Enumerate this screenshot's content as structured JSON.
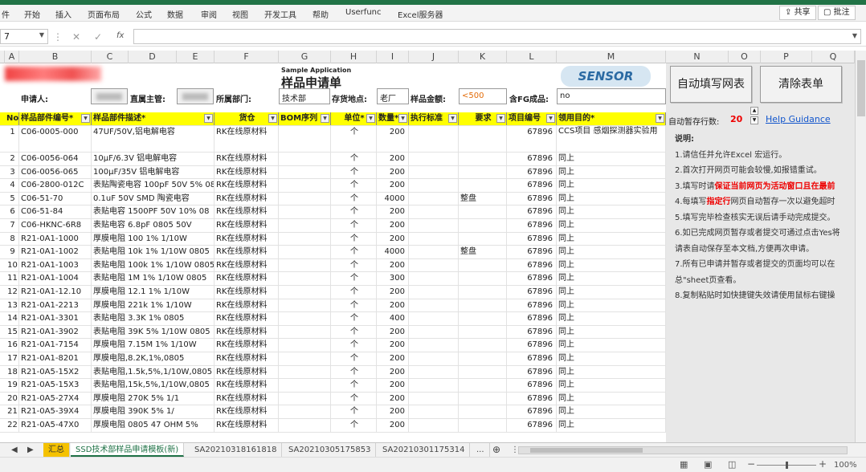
{
  "menu": {
    "items": [
      "件",
      "开始",
      "插入",
      "页面布局",
      "公式",
      "数据",
      "审阅",
      "视图",
      "开发工具",
      "帮助",
      "Userfunc",
      "Excel服务器"
    ],
    "share": "共享",
    "comment": "批注"
  },
  "formula_bar": {
    "name_box": "7",
    "fx": "fx",
    "content": ""
  },
  "columns": [
    "A",
    "B",
    "C",
    "D",
    "E",
    "F",
    "G",
    "H",
    "I",
    "J",
    "K",
    "L",
    "M",
    "N",
    "O",
    "P",
    "Q"
  ],
  "form": {
    "sample_application": "Sample Application",
    "title": "样品申请单",
    "applicant_label": "申请人:",
    "supervisor_label": "直属主管:",
    "dept_label": "所属部门:",
    "dept_value": "技术部",
    "location_label": "存货地点:",
    "location_value": "老厂",
    "amount_label": "样品金额:",
    "amount_value": "<500",
    "fg_label": "含FG成品:",
    "fg_value": "no",
    "logo_text": "SENSOR"
  },
  "table": {
    "headers": [
      "No",
      "样品部件编号*",
      "样品部件描述*",
      "货仓",
      "BOM序列",
      "单位*",
      "数量*",
      "执行标准",
      "要求",
      "项目编号",
      "领用目的*"
    ],
    "rows": [
      {
        "no": "1",
        "part": "C06-0005-000",
        "desc": "47UF/50V,铝电解电容",
        "wh": "RK在线原材料",
        "unit": "个",
        "qty": "200",
        "req": "",
        "proj": "67896",
        "purpose": "CCS项目 感烟探测器实验用"
      },
      {
        "no": "2",
        "part": "C06-0056-064",
        "desc": "10μF/6.3V 铝电解电容",
        "wh": "RK在线原材料",
        "unit": "个",
        "qty": "200",
        "req": "",
        "proj": "67896",
        "purpose": "同上"
      },
      {
        "no": "3",
        "part": "C06-0056-065",
        "desc": "100μF/35V 铝电解电容",
        "wh": "RK在线原材料",
        "unit": "个",
        "qty": "200",
        "req": "",
        "proj": "67896",
        "purpose": "同上"
      },
      {
        "no": "4",
        "part": "C06-2800-012C",
        "desc": "表贴陶瓷电容 100pF 50V 5% 080",
        "wh": "RK在线原材料",
        "unit": "个",
        "qty": "200",
        "req": "",
        "proj": "67896",
        "purpose": "同上"
      },
      {
        "no": "5",
        "part": "C06-51-70",
        "desc": "0.1uF 50V SMD 陶瓷电容",
        "wh": "RK在线原材料",
        "unit": "个",
        "qty": "4000",
        "req": "整盘",
        "proj": "67896",
        "purpose": "同上"
      },
      {
        "no": "6",
        "part": "C06-51-84",
        "desc": "表贴电容  1500PF  50V  10%  08",
        "wh": "RK在线原材料",
        "unit": "个",
        "qty": "200",
        "req": "",
        "proj": "67896",
        "purpose": "同上"
      },
      {
        "no": "7",
        "part": "C06-HKNC-6R8",
        "desc": "表贴电容  6.8pF   0805  50V",
        "wh": "RK在线原材料",
        "unit": "个",
        "qty": "200",
        "req": "",
        "proj": "67896",
        "purpose": "同上"
      },
      {
        "no": "8",
        "part": "R21-0A1-1000",
        "desc": "厚膜电阻 100 1% 1/10W",
        "wh": "RK在线原材料",
        "unit": "个",
        "qty": "200",
        "req": "",
        "proj": "67896",
        "purpose": "同上"
      },
      {
        "no": "9",
        "part": "R21-0A1-1002",
        "desc": "表贴电阻 10k 1%  1/10W  0805",
        "wh": "RK在线原材料",
        "unit": "个",
        "qty": "4000",
        "req": "整盘",
        "proj": "67896",
        "purpose": "同上"
      },
      {
        "no": "10",
        "part": "R21-0A1-1003",
        "desc": "表贴电阻 100k 1%  1/10W  0805",
        "wh": "RK在线原材料",
        "unit": "个",
        "qty": "200",
        "req": "",
        "proj": "67896",
        "purpose": "同上"
      },
      {
        "no": "11",
        "part": "R21-0A1-1004",
        "desc": "表贴电阻 1M  1%  1/10W  0805",
        "wh": "RK在线原材料",
        "unit": "个",
        "qty": "300",
        "req": "",
        "proj": "67896",
        "purpose": "同上"
      },
      {
        "no": "12",
        "part": "R21-0A1-12.10",
        "desc": "厚膜电阻     12.1      1%     1/10W",
        "wh": "RK在线原材料",
        "unit": "个",
        "qty": "200",
        "req": "",
        "proj": "67896",
        "purpose": "同上"
      },
      {
        "no": "13",
        "part": "R21-0A1-2213",
        "desc": "厚膜电阻     221k      1%     1/10W",
        "wh": "RK在线原材料",
        "unit": "个",
        "qty": "200",
        "req": "",
        "proj": "67896",
        "purpose": "同上"
      },
      {
        "no": "14",
        "part": "R21-0A1-3301",
        "desc": "表贴电阻 3.3K  1% 0805",
        "wh": "RK在线原材料",
        "unit": "个",
        "qty": "400",
        "req": "",
        "proj": "67896",
        "purpose": "同上"
      },
      {
        "no": "15",
        "part": "R21-0A1-3902",
        "desc": "表贴电阻   39K  5% 1/10W 0805",
        "wh": "RK在线原材料",
        "unit": "个",
        "qty": "200",
        "req": "",
        "proj": "67896",
        "purpose": "同上"
      },
      {
        "no": "16",
        "part": "R21-0A1-7154",
        "desc": "厚膜电阻     7.15M     1%     1/10W",
        "wh": "RK在线原材料",
        "unit": "个",
        "qty": "200",
        "req": "",
        "proj": "67896",
        "purpose": "同上"
      },
      {
        "no": "17",
        "part": "R21-0A1-8201",
        "desc": "厚膜电阻,8.2K,1%,0805",
        "wh": "RK在线原材料",
        "unit": "个",
        "qty": "200",
        "req": "",
        "proj": "67896",
        "purpose": "同上"
      },
      {
        "no": "18",
        "part": "R21-0A5-15X2",
        "desc": "表贴电阻,1.5k,5%,1/10W,0805",
        "wh": "RK在线原材料",
        "unit": "个",
        "qty": "200",
        "req": "",
        "proj": "67896",
        "purpose": "同上"
      },
      {
        "no": "19",
        "part": "R21-0A5-15X3",
        "desc": "表贴电阻,15k,5%,1/10W,0805",
        "wh": "RK在线原材料",
        "unit": "个",
        "qty": "200",
        "req": "",
        "proj": "67896",
        "purpose": "同上"
      },
      {
        "no": "20",
        "part": "R21-0A5-27X4",
        "desc": "厚膜电阻     270K      5%          1/1",
        "wh": "RK在线原材料",
        "unit": "个",
        "qty": "200",
        "req": "",
        "proj": "67896",
        "purpose": "同上"
      },
      {
        "no": "21",
        "part": "R21-0A5-39X4",
        "desc": "厚膜电阻     390K      5%          1/",
        "wh": "RK在线原材料",
        "unit": "个",
        "qty": "200",
        "req": "",
        "proj": "67896",
        "purpose": "同上"
      },
      {
        "no": "22",
        "part": "R21-0A5-47X0",
        "desc": "厚膜电阻 0805    47 OHM   5%",
        "wh": "RK在线原材料",
        "unit": "个",
        "qty": "200",
        "req": "",
        "proj": "67896",
        "purpose": "同上"
      }
    ]
  },
  "panel": {
    "autofill_button": "自动填写网表",
    "clear_button": "清除表单",
    "autosave_label": "自动暂存行数:",
    "autosave_value": "20",
    "help_link": "Help Guidance",
    "notes_title": "说明:",
    "notes": [
      {
        "text": "1.请信任并允许Excel 宏运行。"
      },
      {
        "text": "2.首次打开网页可能会较慢,如报错重试。"
      },
      {
        "pre": "3.填写时请",
        "hl": "保证当前网页为活动窗口且在最前"
      },
      {
        "pre": "4.每填写",
        "hl": "指定行",
        "post": "网页自动暂存一次以避免超时"
      },
      {
        "text": "5.填写完毕检查核实无误后请手动完成提交。"
      },
      {
        "text": "6.如已完成网页暂存或者提交可通过点击Yes将"
      },
      {
        "text": "请表自动保存至本文档,方便再次申请。"
      },
      {
        "text": "7.所有已申请并暂存或者提交的页面均可以在"
      },
      {
        "text": "总\"sheet页查看。"
      },
      {
        "text": "8.复制粘贴时如快捷键失效请使用鼠标右键操"
      }
    ]
  },
  "tabs": [
    {
      "label": "汇总",
      "active": false,
      "color": "#f5c200"
    },
    {
      "label": "SSD技术部样品申请模板(新)",
      "active": true
    },
    {
      "label": "SA20210318161818"
    },
    {
      "label": "SA20210305175853"
    },
    {
      "label": "SA20210301175314"
    },
    {
      "label": "..."
    }
  ],
  "status": {
    "zoom": "100%"
  }
}
